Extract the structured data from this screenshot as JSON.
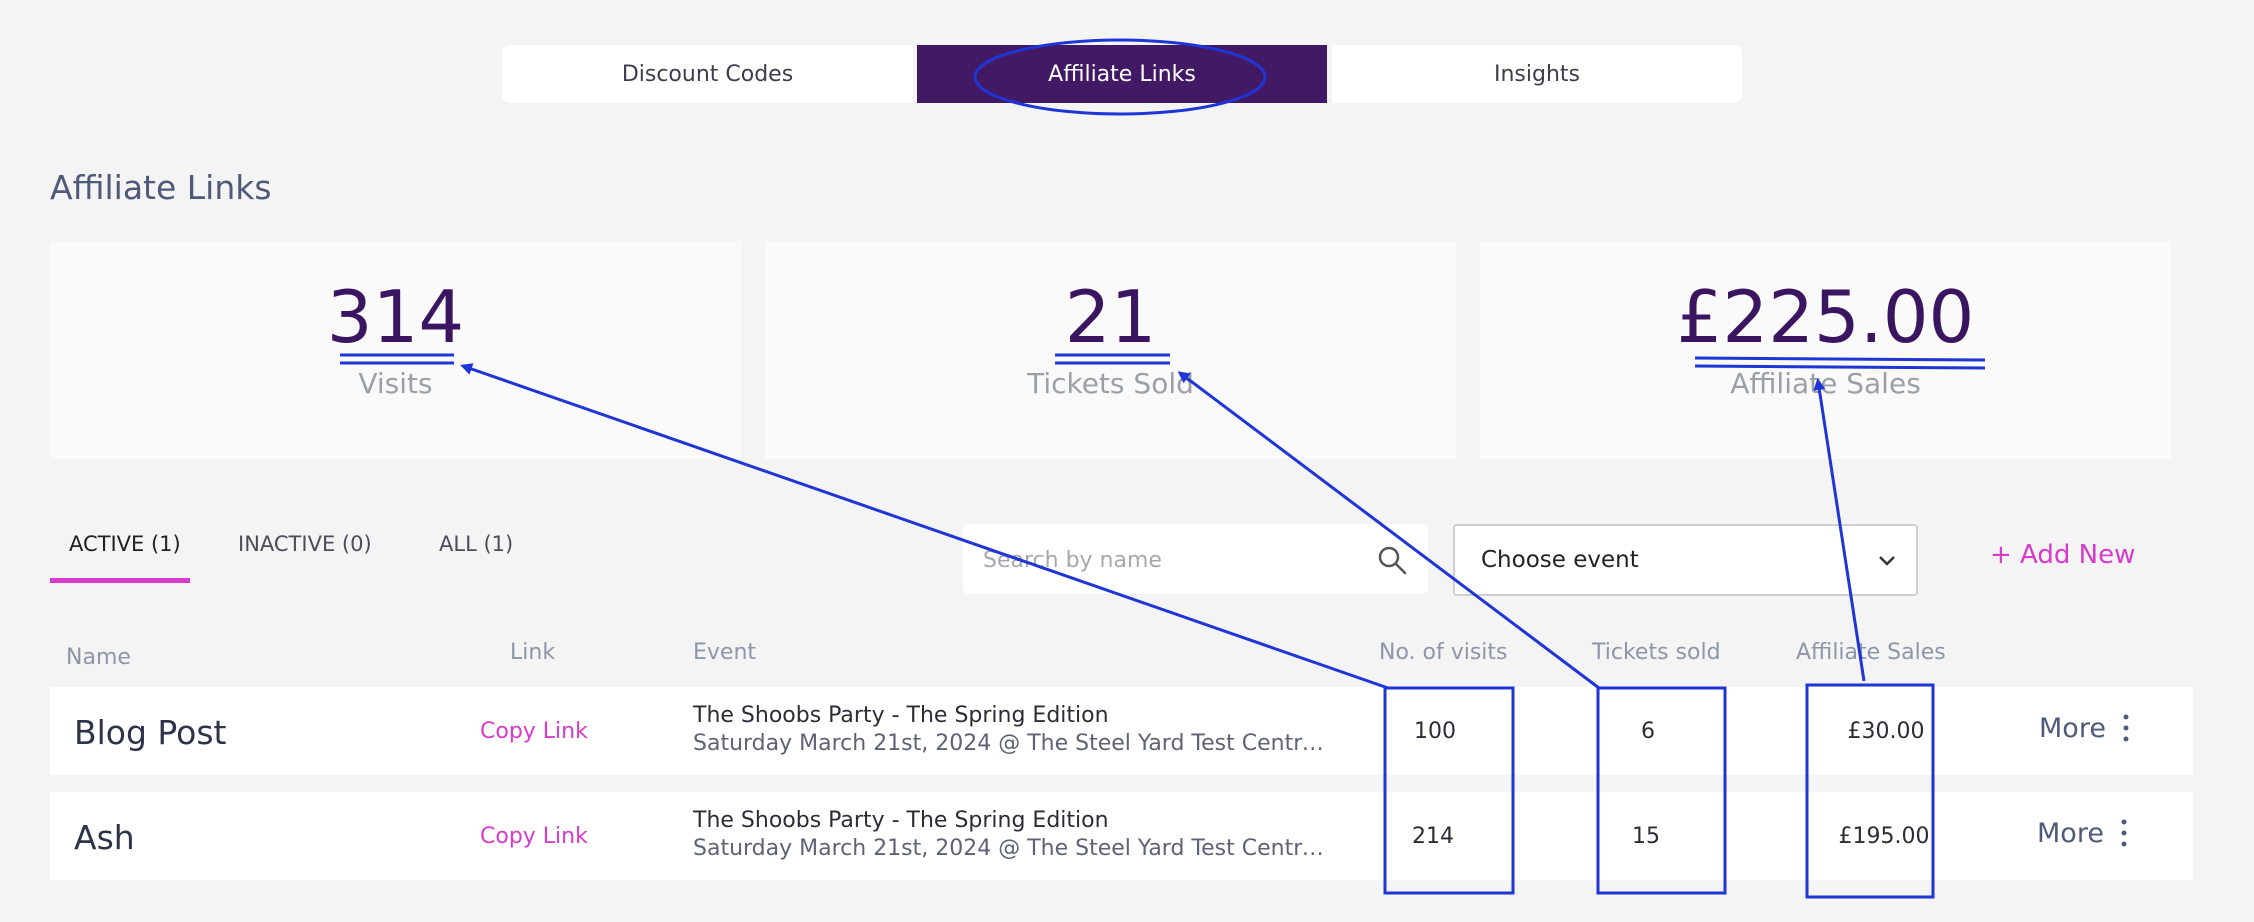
{
  "top_tabs": [
    {
      "label": "Discount Codes"
    },
    {
      "label": "Affiliate Links",
      "active": true
    },
    {
      "label": "Insights"
    }
  ],
  "page_title": "Affiliate Links",
  "stats": [
    {
      "value": "314",
      "label": "Visits"
    },
    {
      "value": "21",
      "label": "Tickets Sold"
    },
    {
      "value": "£225.00",
      "label": "Affiliate Sales"
    }
  ],
  "filter_tabs": [
    {
      "label": "ACTIVE (1)",
      "active": true
    },
    {
      "label": "INACTIVE (0)"
    },
    {
      "label": "ALL (1)"
    }
  ],
  "search": {
    "placeholder": "Search by name",
    "icon": "search-icon"
  },
  "event_select": {
    "value": "Choose event",
    "icon": "chevron-down-icon"
  },
  "add_new_label": "+ Add New",
  "columns": {
    "name": "Name",
    "link": "Link",
    "event": "Event",
    "visits": "No. of visits",
    "tickets": "Tickets sold",
    "sales": "Affiliate Sales"
  },
  "rows": [
    {
      "name": "Blog Post",
      "link": "Copy Link",
      "event_title": "The Shoobs Party - The Spring Edition",
      "event_detail": "Saturday March 21st, 2024 @ The Steel Yard Test Centre i...",
      "visits": "100",
      "tickets": "6",
      "sales": "£30.00",
      "more": "More"
    },
    {
      "name": "Ash",
      "link": "Copy Link",
      "event_title": "The Shoobs Party - The Spring Edition",
      "event_detail": "Saturday March 21st, 2024 @ The Steel Yard Test Centre i...",
      "visits": "214",
      "tickets": "15",
      "sales": "£195.00",
      "more": "More"
    }
  ],
  "colors": {
    "brand_purple": "#421965",
    "accent_pink": "#d63bc9",
    "annotation_blue": "#1f35d6"
  }
}
